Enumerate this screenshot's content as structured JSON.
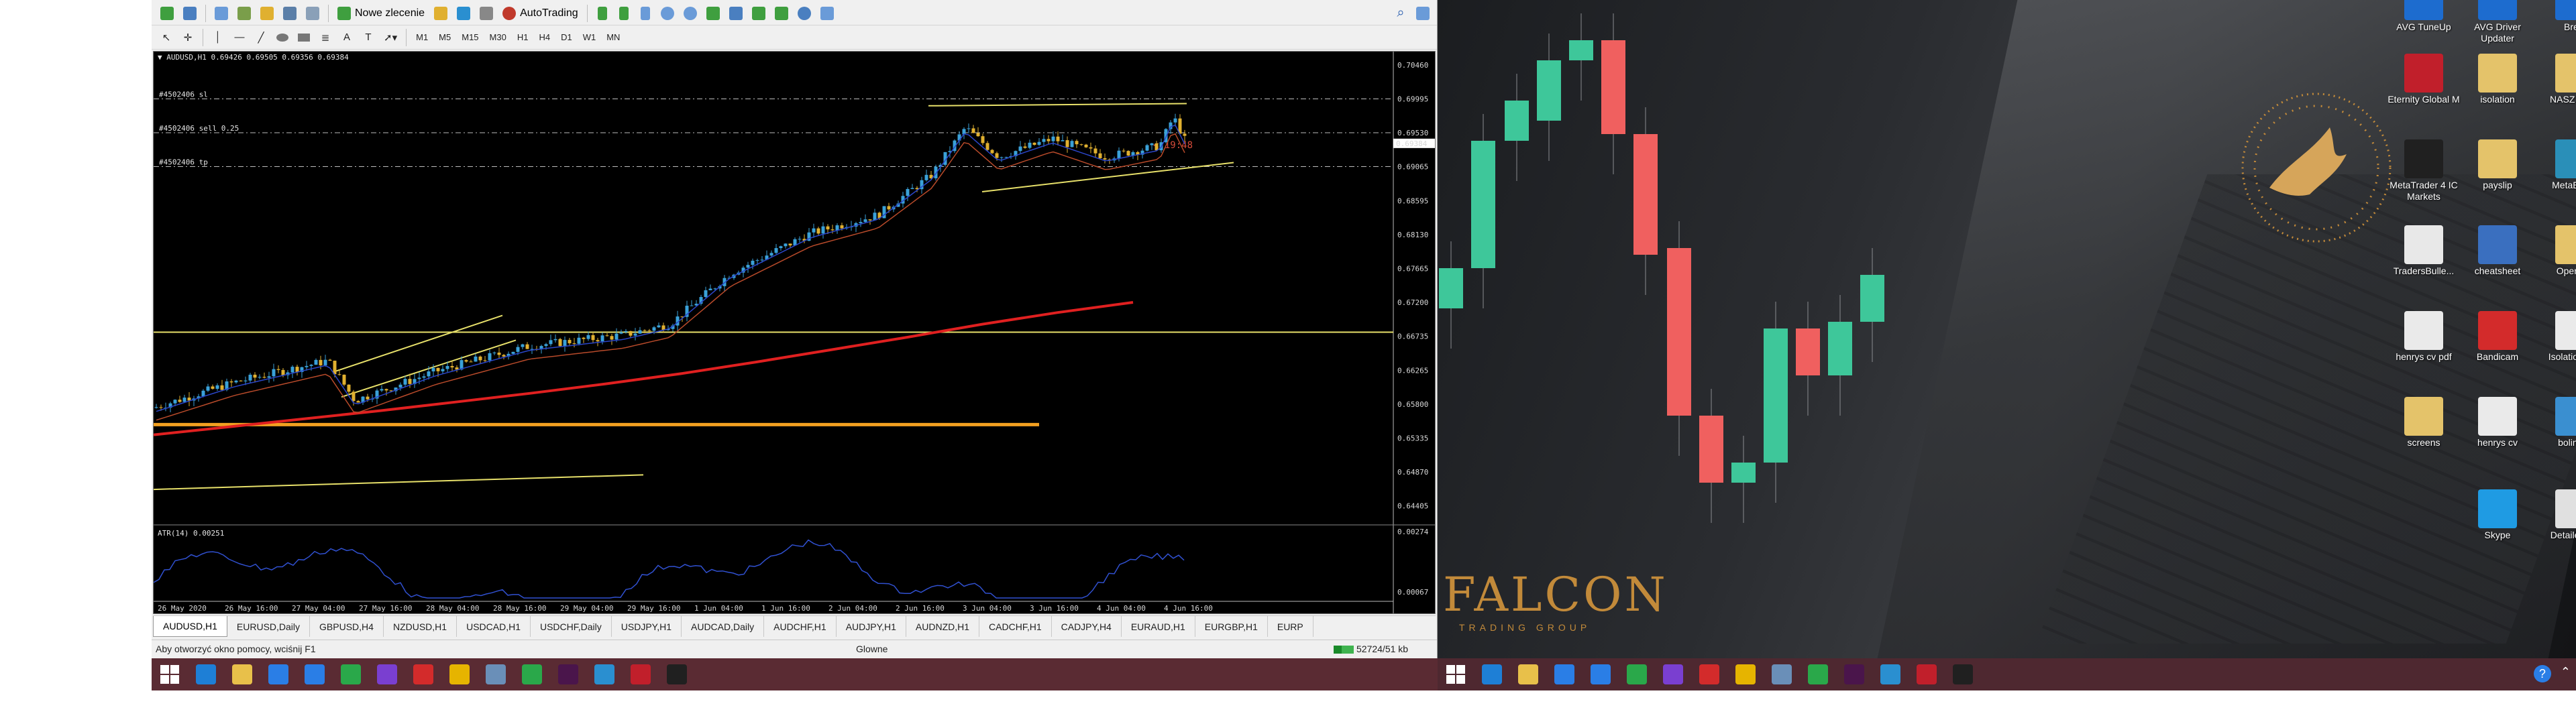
{
  "toolbar": {
    "new_order_label": "Nowe zlecenie",
    "autotrading_label": "AutoTrading",
    "timeframes": [
      "M1",
      "M5",
      "M15",
      "M30",
      "H1",
      "H4",
      "D1",
      "W1",
      "MN"
    ]
  },
  "chart": {
    "header": "AUDUSD,H1  0.69426 0.69505 0.69356 0.69384",
    "orders": [
      {
        "label": "#4502406 sl",
        "y": 0.69995
      },
      {
        "label": "#4502406 sell 0.25",
        "y": 0.6953
      },
      {
        "label": "#4502406 tp",
        "y": 0.69065
      }
    ],
    "countdown": "<-19:48",
    "current_price": "0.69384",
    "indicator_label": "ATR(14) 0.00251",
    "indicator_ticks": [
      "0.00274",
      "0.00067"
    ]
  },
  "chart_data": {
    "type": "candlestick",
    "title": "AUDUSD,H1",
    "ylim": [
      0.6429,
      0.7046
    ],
    "y_ticks": [
      0.7046,
      0.69995,
      0.6953,
      0.69065,
      0.68595,
      0.6813,
      0.67665,
      0.672,
      0.66735,
      0.66265,
      0.658,
      0.65335,
      0.6487,
      0.64405
    ],
    "x_ticks": [
      "26 May 2020",
      "26 May 16:00",
      "27 May 04:00",
      "27 May 16:00",
      "28 May 04:00",
      "28 May 16:00",
      "29 May 04:00",
      "29 May 16:00",
      "1 Jun 04:00",
      "1 Jun 16:00",
      "2 Jun 04:00",
      "2 Jun 16:00",
      "3 Jun 04:00",
      "3 Jun 16:00",
      "4 Jun 04:00",
      "4 Jun 16:00"
    ],
    "ma200": [
      0.6538,
      0.6549,
      0.656,
      0.6571,
      0.6583,
      0.6595,
      0.6608,
      0.6622,
      0.6638,
      0.6655,
      0.6672,
      0.669,
      0.6706,
      0.672
    ],
    "support_levels": [
      0.6552,
      0.6679
    ],
    "colors": {
      "bull": "#3aa1d8",
      "bear": "#e0b030",
      "ma": "#e02020",
      "support": "#f2a020",
      "trend": "#e7e06a"
    }
  },
  "tabs": [
    "AUDUSD,H1",
    "EURUSD,Daily",
    "GBPUSD,H4",
    "NZDUSD,H1",
    "USDCAD,H1",
    "USDCHF,Daily",
    "USDJPY,H1",
    "AUDCAD,Daily",
    "AUDCHF,H1",
    "AUDJPY,H1",
    "AUDNZD,H1",
    "CADCHF,H1",
    "CADJPY,H4",
    "EURAUD,H1",
    "EURGBP,H1",
    "EURP"
  ],
  "status": {
    "help": "Aby otworzyć okno pomocy, wciśnij F1",
    "profile": "Glowne",
    "traffic": "52724/51 kb"
  },
  "desktop": {
    "brand": "FALCON",
    "brand_sub": "TRADING GROUP",
    "icons": [
      {
        "label": "AVG TuneUp",
        "color": "#1d6ccf"
      },
      {
        "label": "AVG Driver Updater",
        "color": "#1d6ccf"
      },
      {
        "label": "Brevi",
        "color": "#1d6ccf"
      },
      {
        "label": "Eternity Global M",
        "color": "#c11f2b"
      },
      {
        "label": "isolation",
        "color": "#e4c36a"
      },
      {
        "label": "NASZ DOM",
        "color": "#e4c36a"
      },
      {
        "label": "MetaTrader 4 IC Markets",
        "color": "#202020"
      },
      {
        "label": "payslip",
        "color": "#e4c36a"
      },
      {
        "label": "MetaEditor",
        "color": "#2a8fb8"
      },
      {
        "label": "TradersBulle...",
        "color": "#e8e8e8"
      },
      {
        "label": "cheatsheet",
        "color": "#3a6fbf"
      },
      {
        "label": "Openbro",
        "color": "#e4c36a"
      },
      {
        "label": "henrys cv pdf",
        "color": "#eaeaea"
      },
      {
        "label": "Bandicam",
        "color": "#d32b2b"
      },
      {
        "label": "Isolation-N...",
        "color": "#eaeaea"
      },
      {
        "label": "screens",
        "color": "#e4c36a"
      },
      {
        "label": "henrys cv",
        "color": "#eaeaea"
      },
      {
        "label": "bolinger",
        "color": "#3a8fd0"
      },
      {
        "label": "Skype",
        "color": "#1f9be3"
      },
      {
        "label": "DetailedSta",
        "color": "#e0e0e0"
      }
    ]
  },
  "taskbar_left": [
    {
      "name": "start",
      "color": "#ffffff"
    },
    {
      "name": "ie",
      "color": "#1e7fd6"
    },
    {
      "name": "explorer",
      "color": "#e8c04a"
    },
    {
      "name": "dropbox",
      "color": "#2a7ee6"
    },
    {
      "name": "onedrive",
      "color": "#2a7ee6"
    },
    {
      "name": "store",
      "color": "#2aa84a"
    },
    {
      "name": "photos",
      "color": "#7a3fd0"
    },
    {
      "name": "opera",
      "color": "#d32b2b"
    },
    {
      "name": "chrome",
      "color": "#e6b400"
    },
    {
      "name": "paint",
      "color": "#6a8fb8"
    },
    {
      "name": "evernote",
      "color": "#2aa84a"
    },
    {
      "name": "slack",
      "color": "#4a154b"
    },
    {
      "name": "photos2",
      "color": "#2a8fd0"
    },
    {
      "name": "eternity",
      "color": "#c11f2b"
    },
    {
      "name": "metatrader",
      "color": "#202020"
    }
  ]
}
